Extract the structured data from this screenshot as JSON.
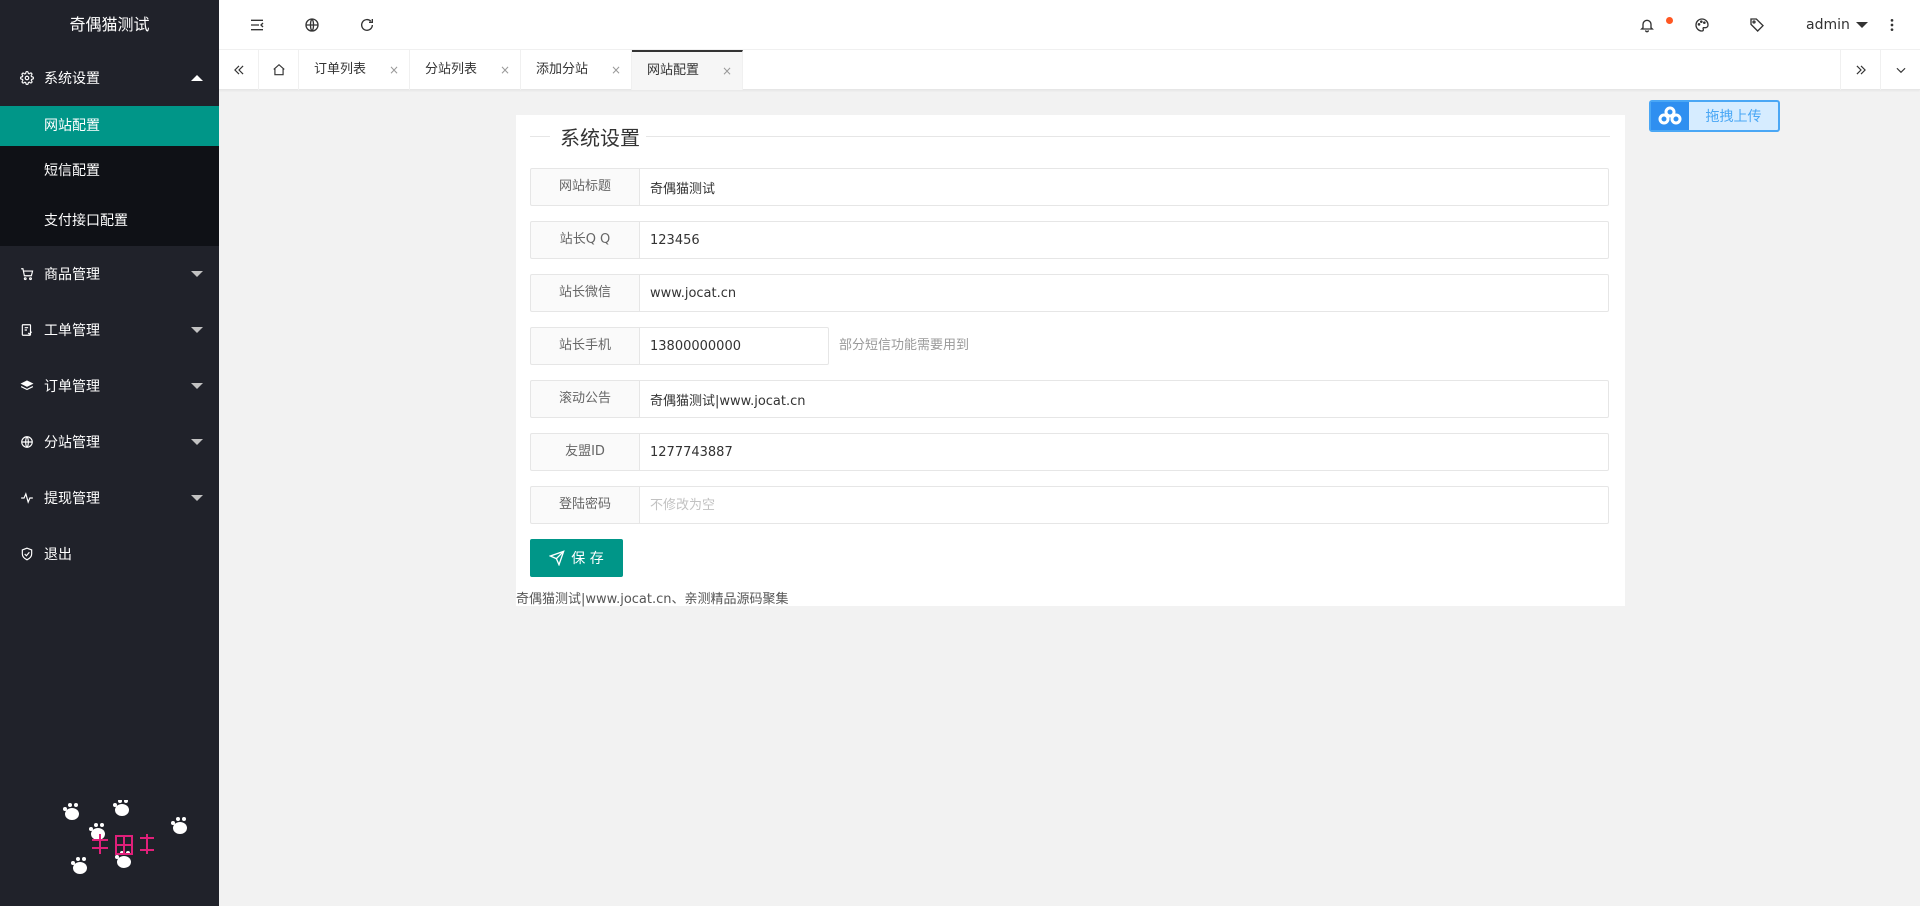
{
  "app": {
    "title": "奇偶猫测试"
  },
  "sidebar": {
    "groups": [
      {
        "label": "系统设置",
        "icon": "gear-icon",
        "expanded": true,
        "items": [
          {
            "label": "网站配置",
            "active": true
          },
          {
            "label": "短信配置",
            "active": false
          },
          {
            "label": "支付接口配置",
            "active": false
          }
        ]
      },
      {
        "label": "商品管理",
        "icon": "cart-icon"
      },
      {
        "label": "工单管理",
        "icon": "ticket-icon"
      },
      {
        "label": "订单管理",
        "icon": "layers-icon"
      },
      {
        "label": "分站管理",
        "icon": "globe-icon"
      },
      {
        "label": "提现管理",
        "icon": "pulse-icon"
      },
      {
        "label": "退出",
        "icon": "shield-icon"
      }
    ]
  },
  "header": {
    "user": "admin",
    "icons": [
      "menu-fold-icon",
      "globe-icon",
      "refresh-icon",
      "bell-icon",
      "palette-icon",
      "tag-icon",
      "more-vertical-icon"
    ],
    "has_notification": true
  },
  "tabs": {
    "items": [
      {
        "label": "订单列表",
        "active": false
      },
      {
        "label": "分站列表",
        "active": false
      },
      {
        "label": "添加分站",
        "active": false
      },
      {
        "label": "网站配置",
        "active": true
      }
    ],
    "close_glyph": "×"
  },
  "form": {
    "legend": "系统设置",
    "fields": [
      {
        "label": "网站标题",
        "value": "奇偶猫测试",
        "placeholder": ""
      },
      {
        "label": "站长Q Q",
        "value": "123456",
        "placeholder": ""
      },
      {
        "label": "站长微信",
        "value": "www.jocat.cn",
        "placeholder": ""
      },
      {
        "label": "站长手机",
        "value": "13800000000",
        "placeholder": "",
        "aux": "部分短信功能需要用到"
      },
      {
        "label": "滚动公告",
        "value": "奇偶猫测试|www.jocat.cn",
        "placeholder": ""
      },
      {
        "label": "友盟ID",
        "value": "1277743887",
        "placeholder": ""
      },
      {
        "label": "登陆密码",
        "value": "",
        "placeholder": "不修改为空"
      }
    ],
    "save_label": "保 存",
    "footer": "奇偶猫测试|www.jocat.cn、亲测精品源码聚集"
  },
  "upload_widget": {
    "label": "拖拽上传",
    "accent": "#4aa7f5"
  },
  "colors": {
    "sidebar_bg": "#20222a",
    "active": "#009688",
    "notice": "#ff5722"
  }
}
